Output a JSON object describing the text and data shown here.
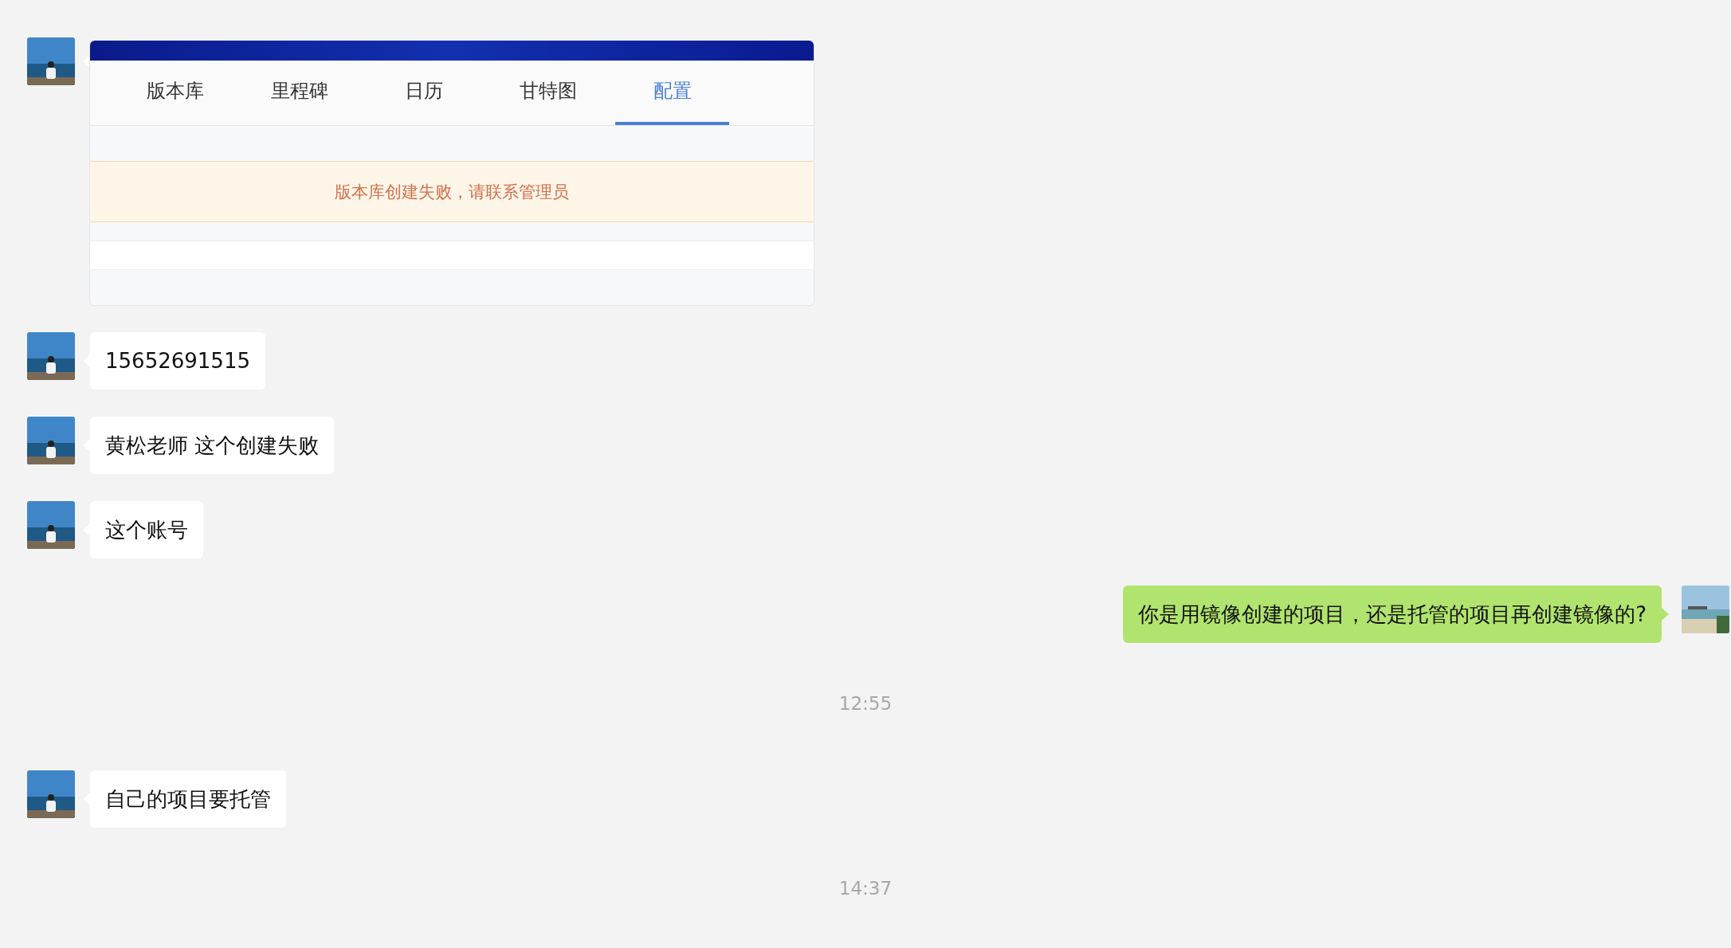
{
  "messages": [
    {
      "kind": "image",
      "outgoing": false,
      "tabs": [
        {
          "label": "版本库",
          "selected": false
        },
        {
          "label": "里程碑",
          "selected": false
        },
        {
          "label": "日历",
          "selected": false
        },
        {
          "label": "甘特图",
          "selected": false
        },
        {
          "label": "配置",
          "selected": true
        }
      ],
      "alert": "版本库创建失败，请联系管理员"
    },
    {
      "kind": "text",
      "outgoing": false,
      "text": "15652691515"
    },
    {
      "kind": "text",
      "outgoing": false,
      "text": "黄松老师 这个创建失败"
    },
    {
      "kind": "text",
      "outgoing": false,
      "text": "这个账号"
    },
    {
      "kind": "text",
      "outgoing": true,
      "text": "你是用镜像创建的项目，还是托管的项目再创建镜像的?"
    },
    {
      "kind": "time",
      "text": "12:55"
    },
    {
      "kind": "text",
      "outgoing": false,
      "text": "自己的项目要托管"
    },
    {
      "kind": "time",
      "text": "14:37"
    }
  ]
}
